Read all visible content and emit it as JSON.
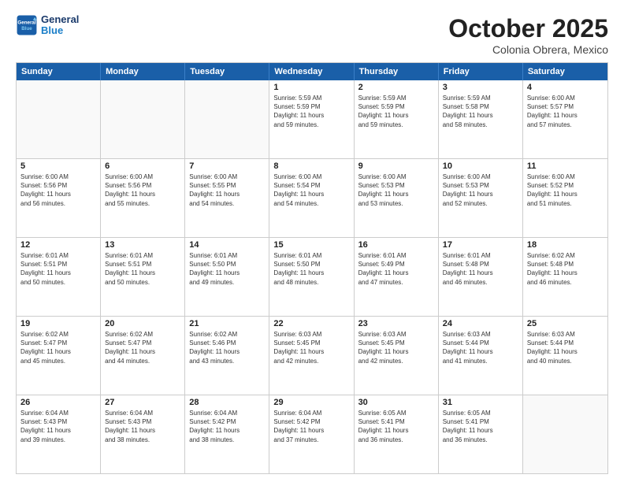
{
  "header": {
    "logo_line1": "General",
    "logo_line2": "Blue",
    "month": "October 2025",
    "location": "Colonia Obrera, Mexico"
  },
  "weekdays": [
    "Sunday",
    "Monday",
    "Tuesday",
    "Wednesday",
    "Thursday",
    "Friday",
    "Saturday"
  ],
  "rows": [
    [
      {
        "day": "",
        "detail": ""
      },
      {
        "day": "",
        "detail": ""
      },
      {
        "day": "",
        "detail": ""
      },
      {
        "day": "1",
        "detail": "Sunrise: 5:59 AM\nSunset: 5:59 PM\nDaylight: 11 hours\nand 59 minutes."
      },
      {
        "day": "2",
        "detail": "Sunrise: 5:59 AM\nSunset: 5:59 PM\nDaylight: 11 hours\nand 59 minutes."
      },
      {
        "day": "3",
        "detail": "Sunrise: 5:59 AM\nSunset: 5:58 PM\nDaylight: 11 hours\nand 58 minutes."
      },
      {
        "day": "4",
        "detail": "Sunrise: 6:00 AM\nSunset: 5:57 PM\nDaylight: 11 hours\nand 57 minutes."
      }
    ],
    [
      {
        "day": "5",
        "detail": "Sunrise: 6:00 AM\nSunset: 5:56 PM\nDaylight: 11 hours\nand 56 minutes."
      },
      {
        "day": "6",
        "detail": "Sunrise: 6:00 AM\nSunset: 5:56 PM\nDaylight: 11 hours\nand 55 minutes."
      },
      {
        "day": "7",
        "detail": "Sunrise: 6:00 AM\nSunset: 5:55 PM\nDaylight: 11 hours\nand 54 minutes."
      },
      {
        "day": "8",
        "detail": "Sunrise: 6:00 AM\nSunset: 5:54 PM\nDaylight: 11 hours\nand 54 minutes."
      },
      {
        "day": "9",
        "detail": "Sunrise: 6:00 AM\nSunset: 5:53 PM\nDaylight: 11 hours\nand 53 minutes."
      },
      {
        "day": "10",
        "detail": "Sunrise: 6:00 AM\nSunset: 5:53 PM\nDaylight: 11 hours\nand 52 minutes."
      },
      {
        "day": "11",
        "detail": "Sunrise: 6:00 AM\nSunset: 5:52 PM\nDaylight: 11 hours\nand 51 minutes."
      }
    ],
    [
      {
        "day": "12",
        "detail": "Sunrise: 6:01 AM\nSunset: 5:51 PM\nDaylight: 11 hours\nand 50 minutes."
      },
      {
        "day": "13",
        "detail": "Sunrise: 6:01 AM\nSunset: 5:51 PM\nDaylight: 11 hours\nand 50 minutes."
      },
      {
        "day": "14",
        "detail": "Sunrise: 6:01 AM\nSunset: 5:50 PM\nDaylight: 11 hours\nand 49 minutes."
      },
      {
        "day": "15",
        "detail": "Sunrise: 6:01 AM\nSunset: 5:50 PM\nDaylight: 11 hours\nand 48 minutes."
      },
      {
        "day": "16",
        "detail": "Sunrise: 6:01 AM\nSunset: 5:49 PM\nDaylight: 11 hours\nand 47 minutes."
      },
      {
        "day": "17",
        "detail": "Sunrise: 6:01 AM\nSunset: 5:48 PM\nDaylight: 11 hours\nand 46 minutes."
      },
      {
        "day": "18",
        "detail": "Sunrise: 6:02 AM\nSunset: 5:48 PM\nDaylight: 11 hours\nand 46 minutes."
      }
    ],
    [
      {
        "day": "19",
        "detail": "Sunrise: 6:02 AM\nSunset: 5:47 PM\nDaylight: 11 hours\nand 45 minutes."
      },
      {
        "day": "20",
        "detail": "Sunrise: 6:02 AM\nSunset: 5:47 PM\nDaylight: 11 hours\nand 44 minutes."
      },
      {
        "day": "21",
        "detail": "Sunrise: 6:02 AM\nSunset: 5:46 PM\nDaylight: 11 hours\nand 43 minutes."
      },
      {
        "day": "22",
        "detail": "Sunrise: 6:03 AM\nSunset: 5:45 PM\nDaylight: 11 hours\nand 42 minutes."
      },
      {
        "day": "23",
        "detail": "Sunrise: 6:03 AM\nSunset: 5:45 PM\nDaylight: 11 hours\nand 42 minutes."
      },
      {
        "day": "24",
        "detail": "Sunrise: 6:03 AM\nSunset: 5:44 PM\nDaylight: 11 hours\nand 41 minutes."
      },
      {
        "day": "25",
        "detail": "Sunrise: 6:03 AM\nSunset: 5:44 PM\nDaylight: 11 hours\nand 40 minutes."
      }
    ],
    [
      {
        "day": "26",
        "detail": "Sunrise: 6:04 AM\nSunset: 5:43 PM\nDaylight: 11 hours\nand 39 minutes."
      },
      {
        "day": "27",
        "detail": "Sunrise: 6:04 AM\nSunset: 5:43 PM\nDaylight: 11 hours\nand 38 minutes."
      },
      {
        "day": "28",
        "detail": "Sunrise: 6:04 AM\nSunset: 5:42 PM\nDaylight: 11 hours\nand 38 minutes."
      },
      {
        "day": "29",
        "detail": "Sunrise: 6:04 AM\nSunset: 5:42 PM\nDaylight: 11 hours\nand 37 minutes."
      },
      {
        "day": "30",
        "detail": "Sunrise: 6:05 AM\nSunset: 5:41 PM\nDaylight: 11 hours\nand 36 minutes."
      },
      {
        "day": "31",
        "detail": "Sunrise: 6:05 AM\nSunset: 5:41 PM\nDaylight: 11 hours\nand 36 minutes."
      },
      {
        "day": "",
        "detail": ""
      }
    ]
  ]
}
